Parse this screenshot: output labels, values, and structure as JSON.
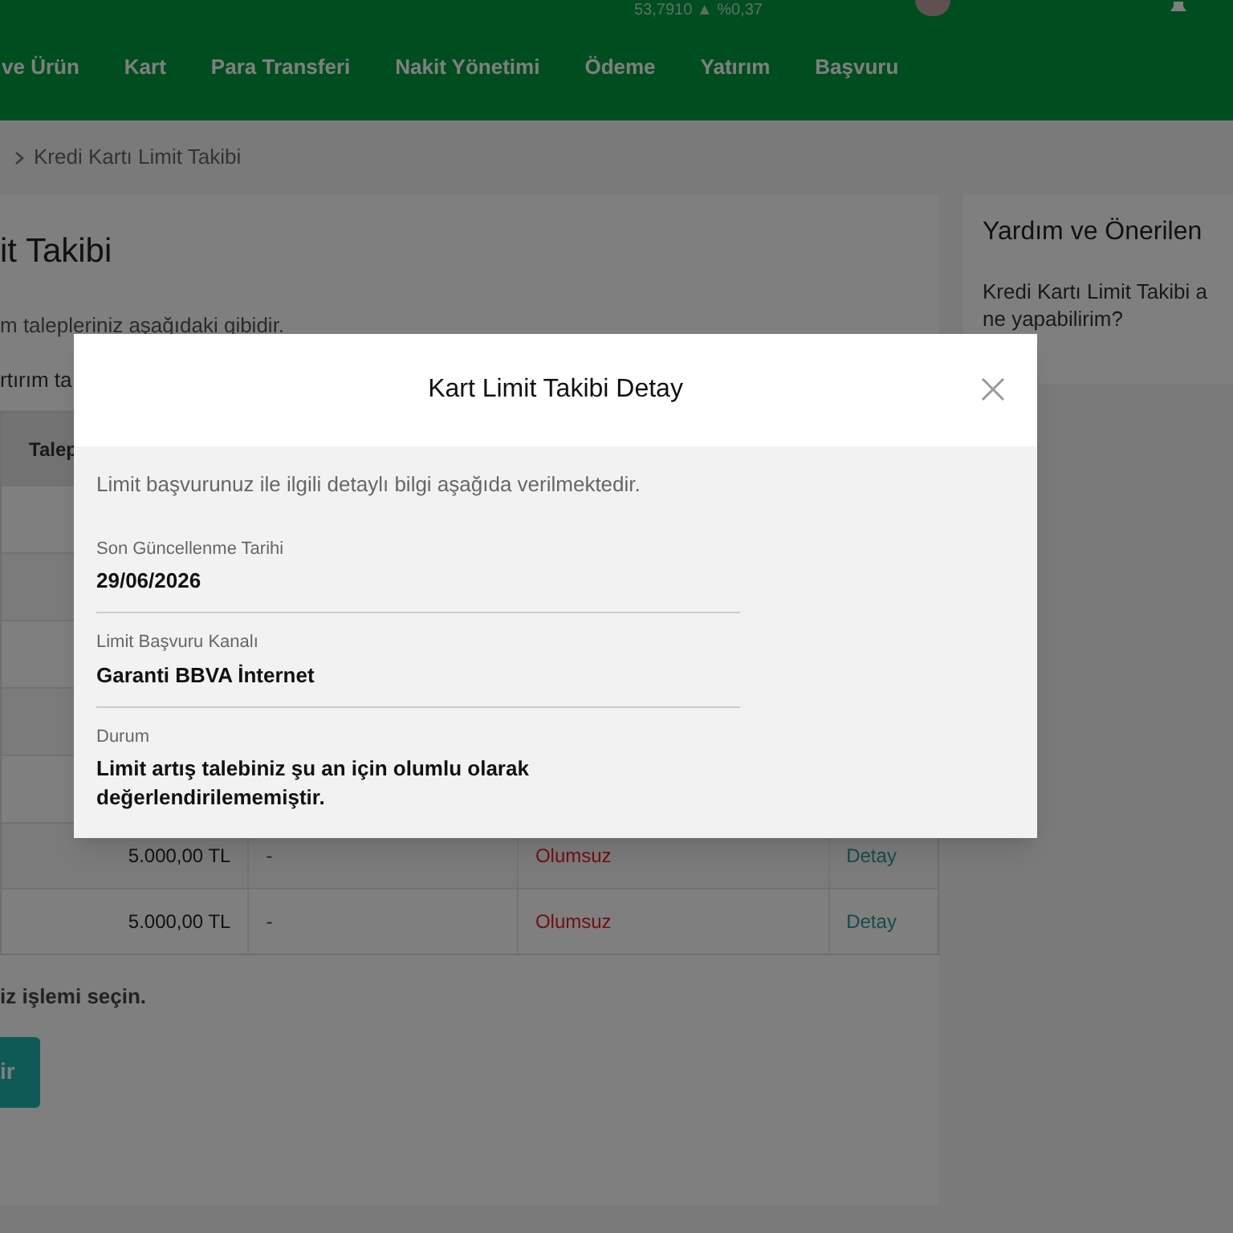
{
  "top_bar": {
    "ticker": "53,7910 ▲ %0,37"
  },
  "nav": {
    "items": [
      "ve Ürün",
      "Kart",
      "Para Transferi",
      "Nakit Yönetimi",
      "Ödeme",
      "Yatırım",
      "Başvuru"
    ]
  },
  "breadcrumb": {
    "current": "Kredi Kartı Limit Takibi"
  },
  "main": {
    "title": "it Takibi",
    "intro": "m talepleriniz aşağıdaki gibidir.",
    "note": "rtırım ta",
    "table": {
      "columns": [
        "Talep"
      ],
      "rows": [
        {
          "amount": "5.000,00 TL",
          "column_2": "-",
          "status": "Olumsuz",
          "action": "Detay"
        },
        {
          "amount": "5.000,00 TL",
          "column_2": "-",
          "status": "Olumsuz",
          "action": "Detay"
        }
      ]
    },
    "hint": "iz işlemi seçin.",
    "button": "ir"
  },
  "help": {
    "title": "Yardım ve Önerilen",
    "lines": [
      "Kredi Kartı Limit Takibi a",
      "ne yapabilirim?"
    ]
  },
  "modal": {
    "title": "Kart Limit Takibi Detay",
    "intro": "Limit başvurunuz ile ilgili detaylı bilgi aşağıda verilmektedir.",
    "fields": [
      {
        "label": "Son Güncellenme Tarihi",
        "value": "29/06/2026"
      },
      {
        "label": "Limit Başvuru Kanalı",
        "value": "Garanti BBVA İnternet"
      },
      {
        "label": "Durum",
        "value": "Limit artış talebiniz şu an için olumlu olarak değerlendirilememiştir."
      }
    ]
  }
}
